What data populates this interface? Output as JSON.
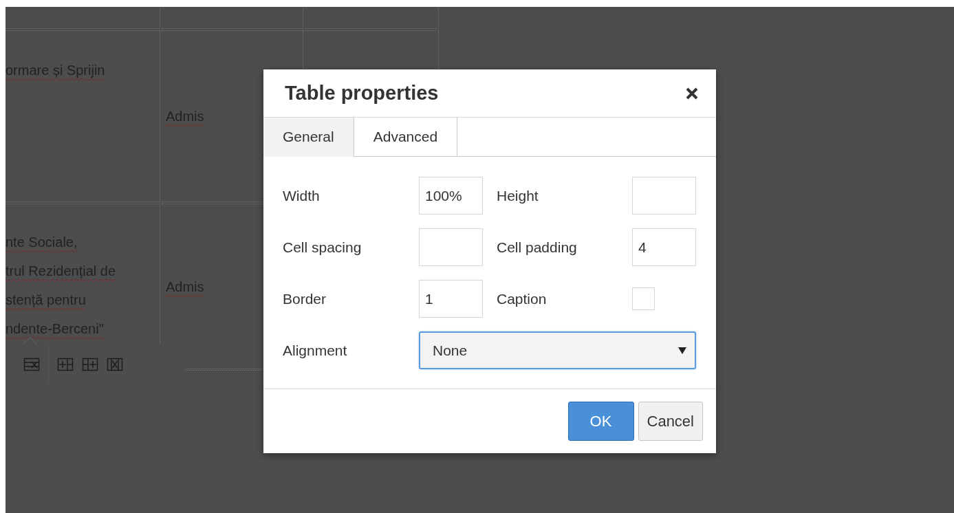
{
  "editor": {
    "table": {
      "rows": [
        {
          "cells": [
            {},
            {},
            {}
          ]
        },
        {
          "cells": [
            {
              "lines": [
                "ormare și Sprijin"
              ]
            },
            {
              "lines": [
                "Admis"
              ]
            },
            {}
          ]
        },
        {
          "cells": [
            {
              "lines": [
                "nte Sociale,",
                "trul Rezidențial de",
                "stență pentru",
                "ndente-Berceni\""
              ]
            },
            {
              "lines": [
                "Admis"
              ]
            },
            {}
          ]
        }
      ]
    },
    "toolbar": [
      {
        "kind": "row-delete"
      },
      {
        "kind": "separator"
      },
      {
        "kind": "col-before"
      },
      {
        "kind": "col-after"
      },
      {
        "kind": "col-delete"
      }
    ]
  },
  "dialog": {
    "title": "Table properties",
    "tabs": [
      {
        "label": "General",
        "selected": true
      },
      {
        "label": "Advanced",
        "selected": false
      }
    ],
    "fields": [
      {
        "label": "Width",
        "kind": "text",
        "value": "100%"
      },
      {
        "label": "Height",
        "kind": "text"
      },
      {
        "label": "Cell spacing",
        "kind": "text"
      },
      {
        "label": "Cell padding",
        "kind": "text",
        "value": "4"
      },
      {
        "label": "Border",
        "kind": "text",
        "value": "1"
      },
      {
        "label": "Caption",
        "kind": "checkbox",
        "checked": false
      },
      {
        "label": "Alignment",
        "kind": "select",
        "value": "None",
        "focused": true
      }
    ],
    "buttons": [
      {
        "label": "OK",
        "kind": "primary"
      },
      {
        "label": "Cancel",
        "kind": "default"
      }
    ]
  }
}
